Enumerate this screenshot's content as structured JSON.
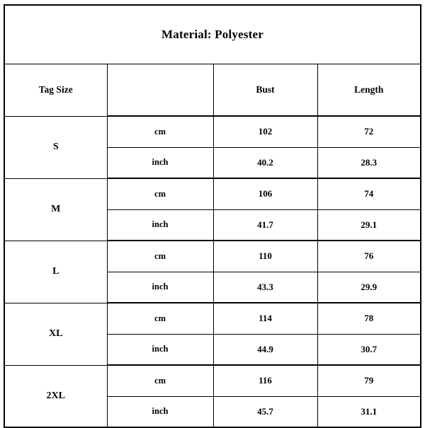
{
  "title": "Material: Polyester",
  "columns": {
    "size": "Tag Size",
    "unit": "",
    "bust": "Bust",
    "length": "Length"
  },
  "units": {
    "cm": "cm",
    "inch": "inch"
  },
  "colors": {
    "shaded_cell": "#bfbfbf",
    "border": "#000000",
    "background": "#ffffff",
    "text": "#000000"
  },
  "rows": [
    {
      "size": "S",
      "cm": {
        "bust": "102",
        "length": "72"
      },
      "inch": {
        "bust": "40.2",
        "length": "28.3"
      }
    },
    {
      "size": "M",
      "cm": {
        "bust": "106",
        "length": "74"
      },
      "inch": {
        "bust": "41.7",
        "length": "29.1"
      }
    },
    {
      "size": "L",
      "cm": {
        "bust": "110",
        "length": "76"
      },
      "inch": {
        "bust": "43.3",
        "length": "29.9"
      }
    },
    {
      "size": "XL",
      "cm": {
        "bust": "114",
        "length": "78"
      },
      "inch": {
        "bust": "44.9",
        "length": "30.7"
      }
    },
    {
      "size": "2XL",
      "cm": {
        "bust": "116",
        "length": "79"
      },
      "inch": {
        "bust": "45.7",
        "length": "31.1"
      }
    }
  ]
}
